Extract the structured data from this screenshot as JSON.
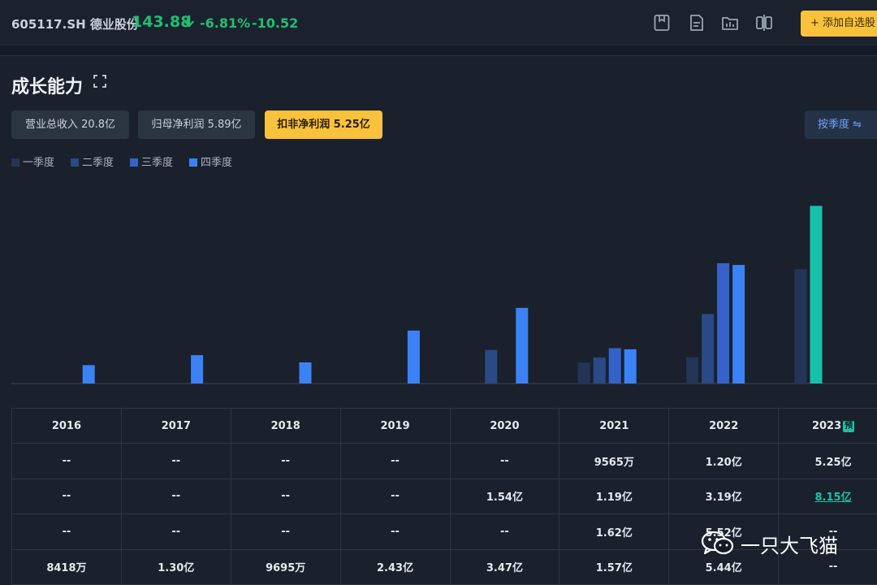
{
  "header": {
    "code": "605117.SH 德业股份",
    "price": "143.88",
    "change_pct": "-6.81%",
    "change_abs": "-10.52",
    "add_button": "+ 添加自选股",
    "tool_icons": [
      "bookmark-icon",
      "note-icon",
      "folder-chart-icon",
      "compare-icon"
    ],
    "colors": {
      "down": "#1fbf73",
      "accent": "#f9c23c"
    }
  },
  "section": {
    "title": "成长能力",
    "metrics": [
      {
        "label": "营业总收入 20.8亿",
        "active": false
      },
      {
        "label": "归母净利润 5.89亿",
        "active": false
      },
      {
        "label": "扣非净利润 5.25亿",
        "active": true
      }
    ],
    "quarter_toggle": "按季度 ⇋"
  },
  "chart_data": {
    "type": "bar",
    "categories": [
      "2016",
      "2017",
      "2018",
      "2019",
      "2020",
      "2021",
      "2022",
      "2023"
    ],
    "series": [
      {
        "name": "一季度",
        "color": "#223556",
        "values": [
          null,
          null,
          null,
          null,
          null,
          0.9565,
          1.2,
          5.25
        ]
      },
      {
        "name": "二季度",
        "color": "#2a4a86",
        "values": [
          null,
          null,
          null,
          null,
          1.54,
          1.19,
          3.19,
          8.15
        ]
      },
      {
        "name": "三季度",
        "color": "#3462c8",
        "values": [
          null,
          null,
          null,
          null,
          null,
          1.62,
          5.52,
          null
        ]
      },
      {
        "name": "四季度",
        "color": "#3b82f6",
        "values": [
          0.8418,
          1.3,
          0.9695,
          2.43,
          3.47,
          1.57,
          5.44,
          null
        ]
      }
    ],
    "forecast_color": "#18c2a8",
    "ylim": [
      0,
      8.5
    ]
  },
  "table": {
    "headers": [
      "2016",
      "2017",
      "2018",
      "2019",
      "2020",
      "2021",
      "2022",
      "2023"
    ],
    "forecast_badge": "预",
    "rows": [
      [
        "--",
        "--",
        "--",
        "--",
        "--",
        "9565万",
        "1.20亿",
        "5.25亿"
      ],
      [
        "--",
        "--",
        "--",
        "--",
        "1.54亿",
        "1.19亿",
        "3.19亿",
        "8.15亿"
      ],
      [
        "--",
        "--",
        "--",
        "--",
        "--",
        "1.62亿",
        "5.52亿",
        "--"
      ],
      [
        "8418万",
        "1.30亿",
        "9695万",
        "2.43亿",
        "3.47亿",
        "1.57亿",
        "5.44亿",
        "--"
      ]
    ]
  },
  "watermark": {
    "text": "一只大飞猫"
  }
}
